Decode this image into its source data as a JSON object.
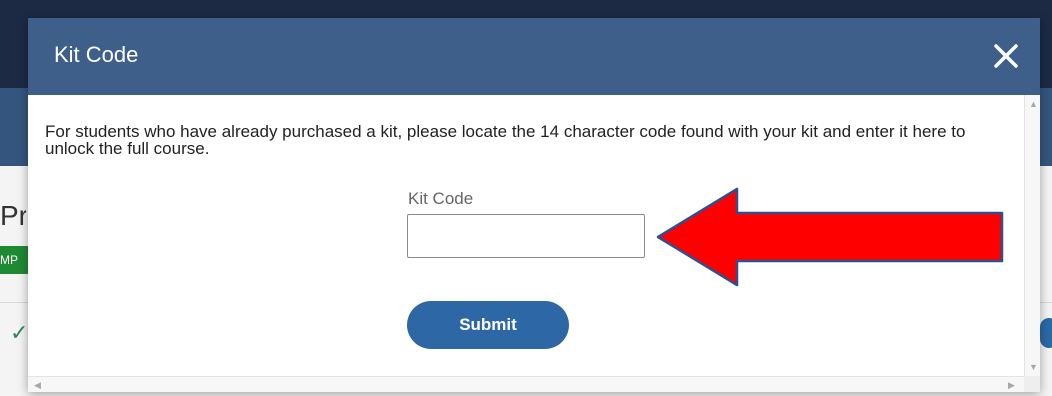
{
  "background_page": {
    "heading_fragment": "Pre",
    "badge_fragment": "MP",
    "check_glyph": "✓"
  },
  "modal": {
    "title": "Kit Code",
    "close_glyph": "✕",
    "description": "For students who have already purchased a kit, please locate the 14 character code found with your kit and enter it here to unlock the full course.",
    "field_label": "Kit Code",
    "input_value": "",
    "input_placeholder": "",
    "submit_label": "Submit"
  },
  "annotation": {
    "arrow_color": "#ff0000",
    "arrow_outline_color": "#2f4f8f",
    "arrow_direction": "left"
  },
  "colors": {
    "header_bg": "#3e5f8a",
    "submit_bg": "#2d67a6"
  },
  "icons": {
    "close": "close-icon",
    "scroll_up": "chevron-up-icon",
    "scroll_down": "chevron-down-icon",
    "scroll_left": "chevron-left-icon",
    "scroll_right": "chevron-right-icon"
  }
}
